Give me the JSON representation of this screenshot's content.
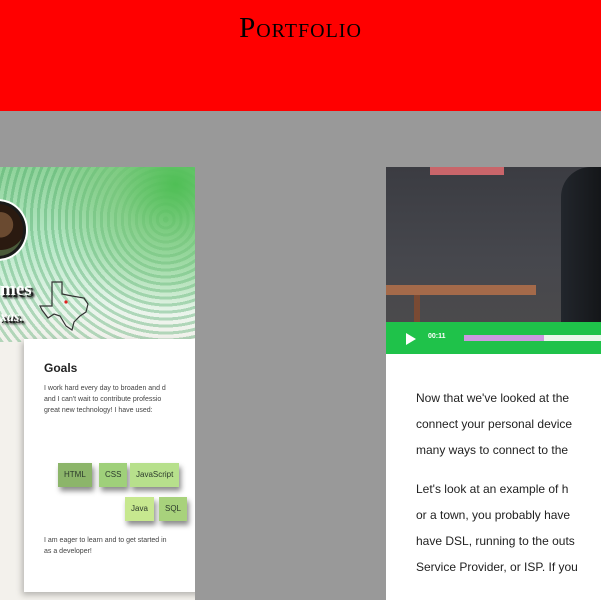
{
  "header": {
    "title": "Portfolio",
    "background": "#ff0000"
  },
  "profile": {
    "name": "mes",
    "location": "xas.",
    "goals": {
      "title": "Goals",
      "intro": "I work hard every day to broaden and d\nand I can't wait to contribute professio\ngreat new technology! I have used:",
      "skills": [
        {
          "label": "HTML",
          "color": "#8cb56a"
        },
        {
          "label": "CSS",
          "color": "#9fd07a"
        },
        {
          "label": "JavaScript",
          "color": "#b7e08c"
        },
        {
          "label": "Java",
          "color": "#c7e88f"
        },
        {
          "label": "SQL",
          "color": "#a8d27c"
        }
      ],
      "closing": "I am eager to learn and to get started in\nas a developer!"
    }
  },
  "video": {
    "time": "00:11",
    "progress": 0.57,
    "accent": "#1fc24a"
  },
  "article": {
    "paragraphs": [
      [
        "Now that we've looked at the",
        "connect your personal device",
        "many ways to connect to the"
      ],
      [
        "Let's look at an example of h",
        "or a town, you probably have",
        "have DSL, running to the outs",
        "Service Provider, or ISP. If you"
      ]
    ]
  }
}
